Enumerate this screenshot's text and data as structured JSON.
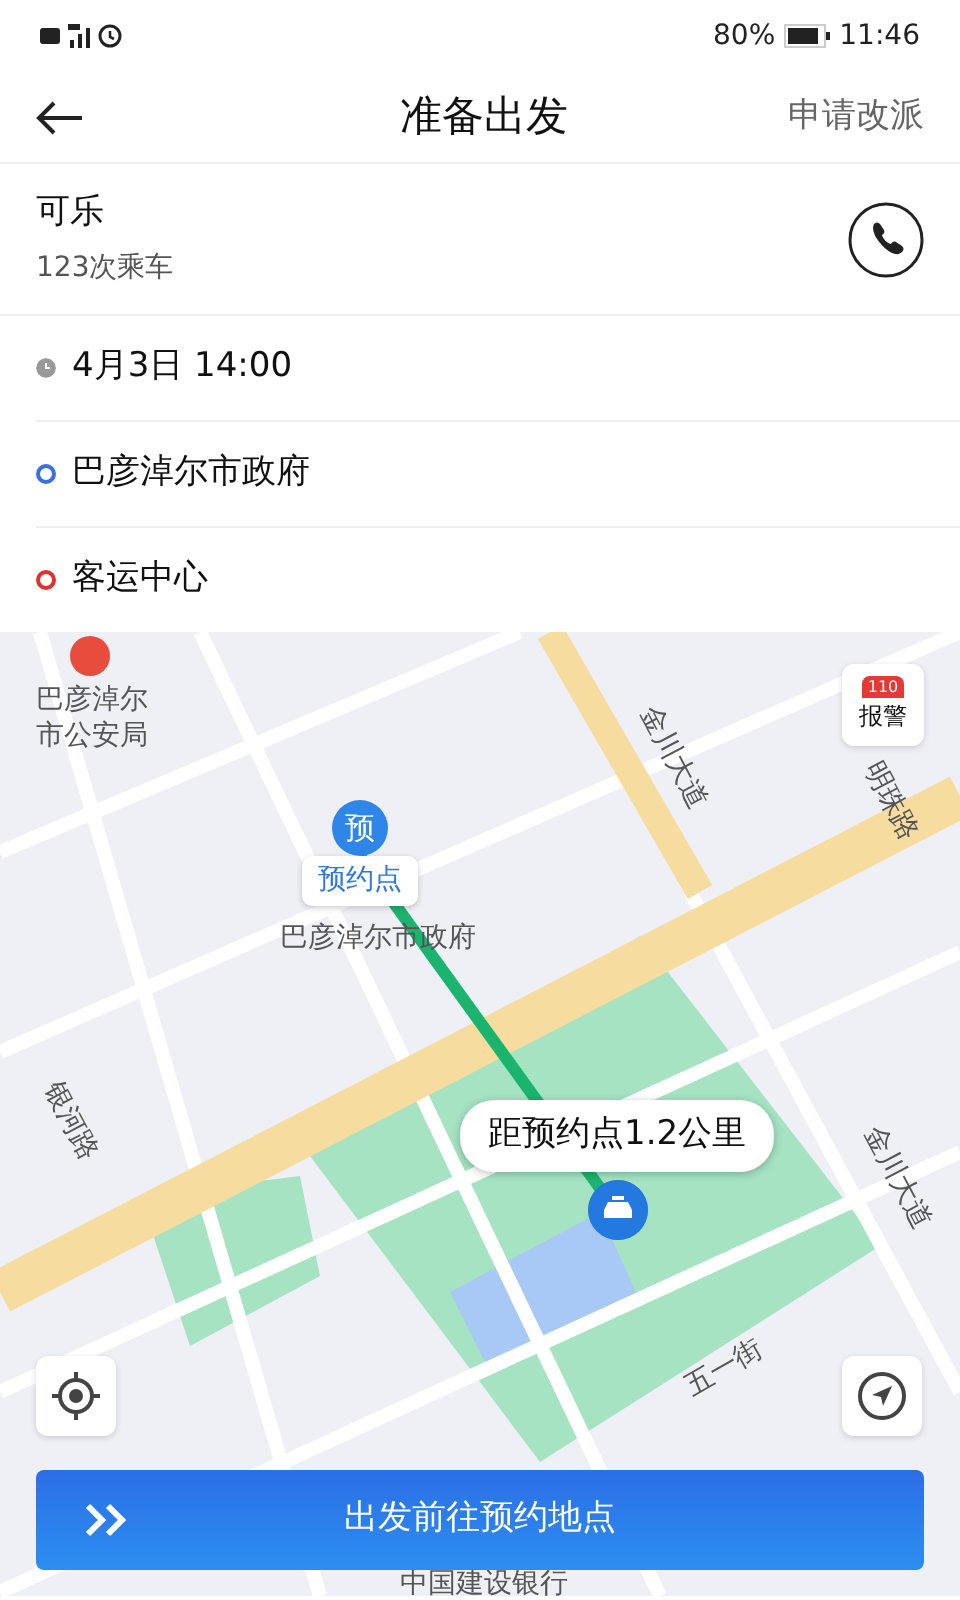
{
  "status_bar": {
    "battery": "80%",
    "time": "11:46"
  },
  "header": {
    "title": "准备出发",
    "action": "申请改派"
  },
  "passenger": {
    "name": "可乐",
    "rides": "123次乘车"
  },
  "trip": [
    {
      "kind": "time",
      "text": "4月3日 14:00"
    },
    {
      "kind": "origin",
      "text": "巴彦淖尔市政府"
    },
    {
      "kind": "destination",
      "text": "客运中心"
    }
  ],
  "map": {
    "labels": [
      "巴彦淖尔",
      "市公安局",
      "巴彦淖尔市政府",
      "金川大道",
      "明珠路",
      "银河路",
      "金川大道",
      "五一街",
      "中国建设银行"
    ],
    "pickup_marker": "预",
    "pickup_label": "预约点",
    "distance": "距预约点1.2公里",
    "alarm": {
      "number": "110",
      "label": "报警"
    }
  },
  "action_button": "出发前往预约地点"
}
